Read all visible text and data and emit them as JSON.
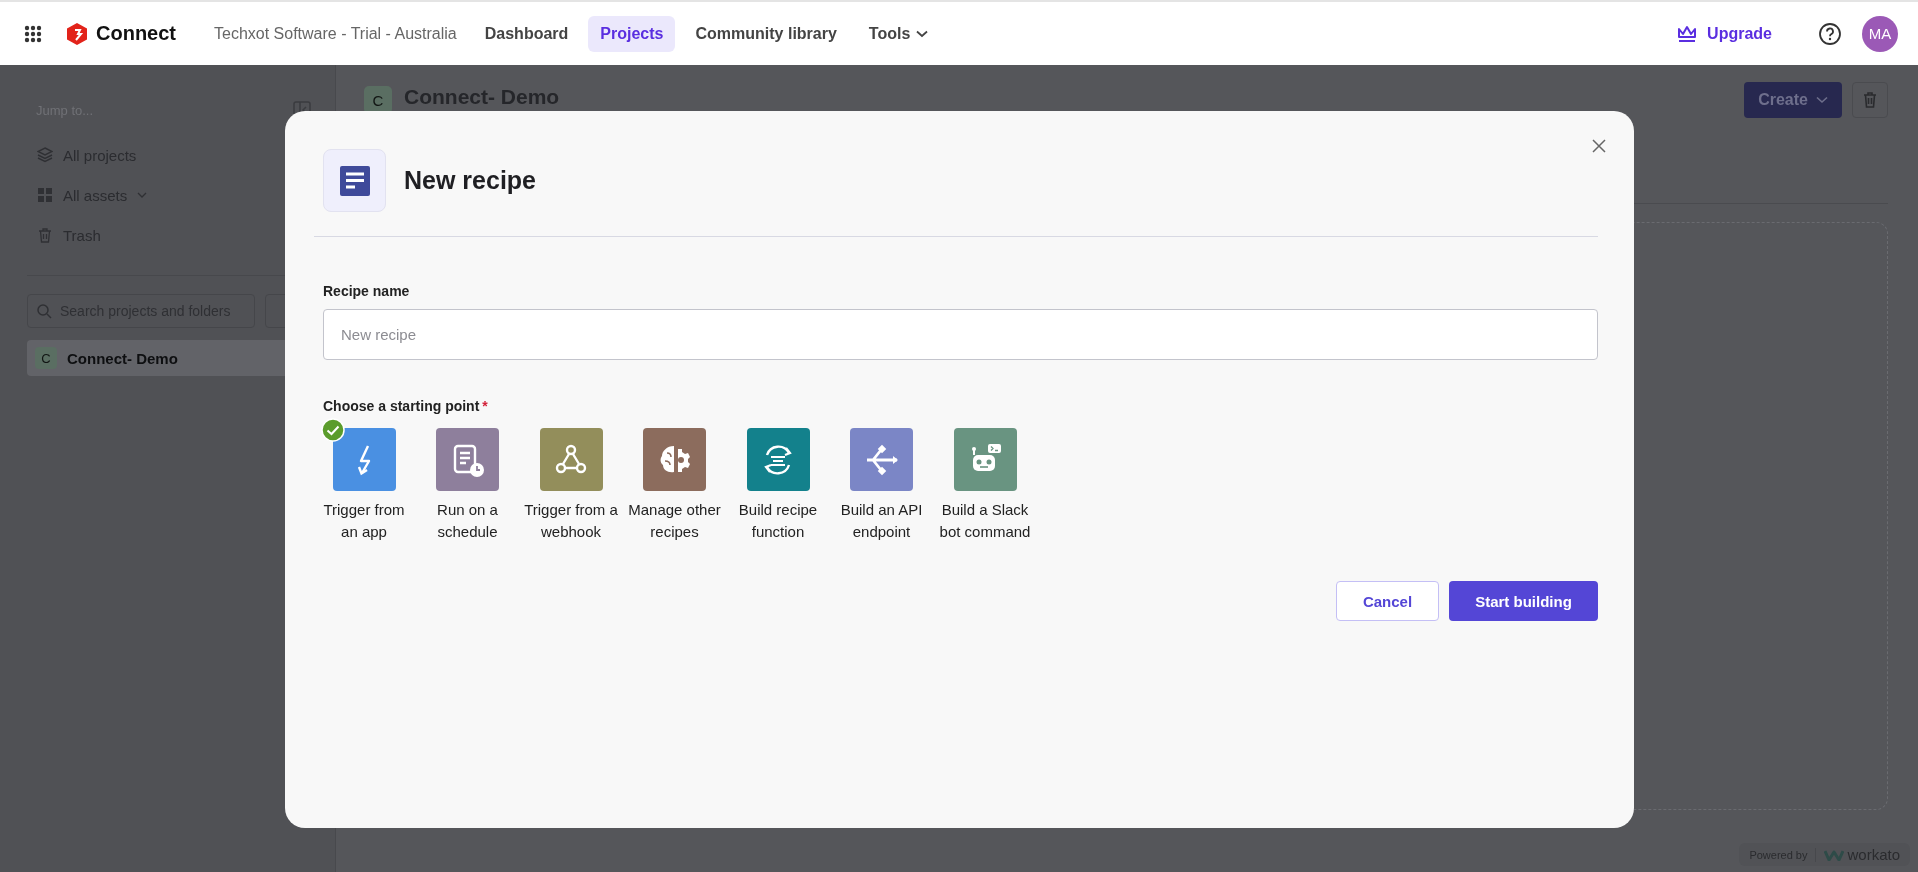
{
  "topbar": {
    "app_name": "Connect",
    "org": "Techxot Software - Trial - Australia",
    "nav": [
      {
        "label": "Dashboard",
        "selected": false,
        "kind": "link"
      },
      {
        "label": "Projects",
        "selected": true,
        "kind": "link"
      },
      {
        "label": "Community library",
        "selected": false,
        "kind": "link"
      },
      {
        "label": "Tools",
        "selected": false,
        "kind": "menu"
      }
    ],
    "upgrade": "Upgrade",
    "avatar": "MA"
  },
  "sidebar": {
    "jump_label": "Jump to...",
    "items": [
      {
        "label": "All projects",
        "kind": "link"
      },
      {
        "label": "All assets",
        "kind": "group"
      },
      {
        "label": "Trash",
        "kind": "link"
      }
    ],
    "search_placeholder": "Search projects and folders",
    "projects": [
      {
        "initial": "C",
        "name": "Connect- Demo",
        "selected": true
      }
    ]
  },
  "main": {
    "project_initial": "C",
    "project_title": "Connect- Demo",
    "create_button": "Create"
  },
  "modal": {
    "title": "New recipe",
    "name_label": "Recipe name",
    "name_placeholder": "New recipe",
    "starting_label": "Choose a starting point",
    "required_mark": "*",
    "starting_points": [
      {
        "label": "Trigger from an app",
        "color": "#4a90e2",
        "selected": true
      },
      {
        "label": "Run on a schedule",
        "color": "#8e7f9c",
        "selected": false
      },
      {
        "label": "Trigger from a webhook",
        "color": "#938e5b",
        "selected": false
      },
      {
        "label": "Manage other recipes",
        "color": "#8c6c5d",
        "selected": false
      },
      {
        "label": "Build recipe function",
        "color": "#13818c",
        "selected": false
      },
      {
        "label": "Build an API endpoint",
        "color": "#7b86c6",
        "selected": false
      },
      {
        "label": "Build a Slack bot command",
        "color": "#699481",
        "selected": false
      }
    ],
    "cancel": "Cancel",
    "submit": "Start building"
  },
  "footer": {
    "powered_by": "Powered by",
    "brand": "workato"
  }
}
